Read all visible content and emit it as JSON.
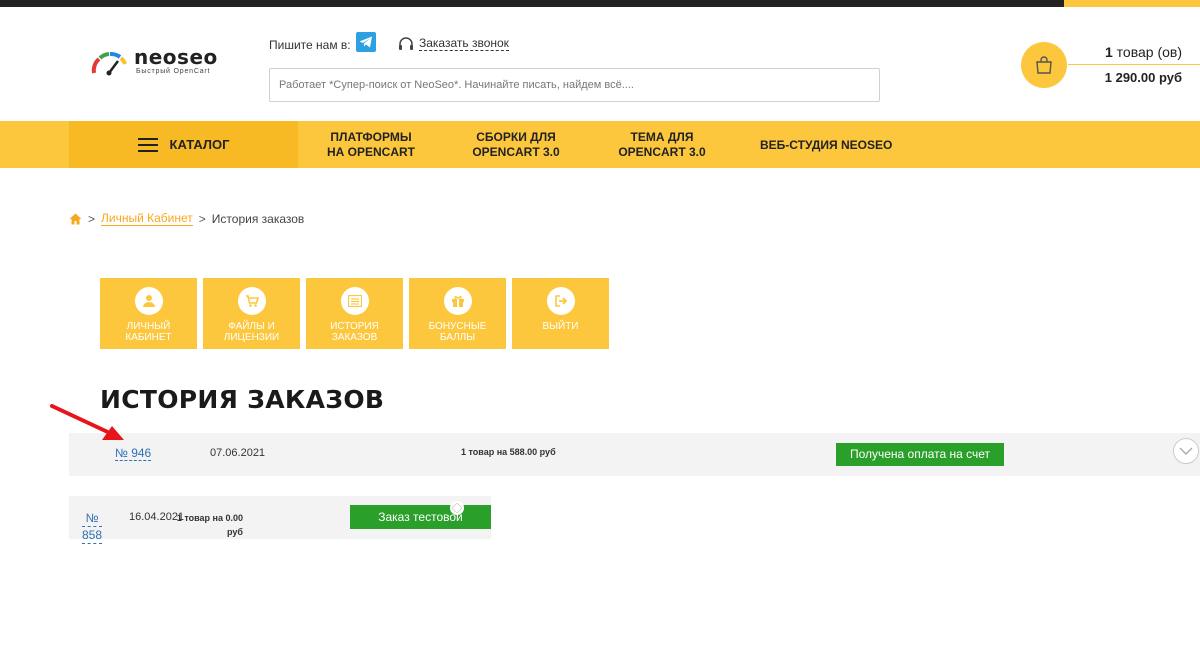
{
  "header": {
    "logo": {
      "name": "neoseo",
      "subtitle": "Быстрый OpenCart"
    },
    "write_us_label": "Пишите нам в:",
    "callback_label": "Заказать звонок",
    "search_placeholder": "Работает *Супер-поиск от NeoSeo*. Начинайте писать, найдем всё....",
    "cart": {
      "count_bold": "1",
      "count_rest": " товар (ов)",
      "total": "1 290.00 руб"
    }
  },
  "nav": {
    "catalog_label": "КАТАЛОГ",
    "items": [
      {
        "line1": "ПЛАТФОРМЫ",
        "line2": "НА OPENCART"
      },
      {
        "line1": "СБОРКИ ДЛЯ",
        "line2": "OPENCART 3.0"
      },
      {
        "line1": "ТЕМА ДЛЯ",
        "line2": "OPENCART 3.0"
      },
      {
        "line1": "ВЕБ-СТУДИЯ NEOSEO",
        "line2": ""
      }
    ]
  },
  "breadcrumb": {
    "separator": ">",
    "account_link": "Личный Кабинет",
    "current": "История заказов"
  },
  "tiles": [
    {
      "line1": "ЛИЧНЫЙ",
      "line2": "КАБИНЕТ",
      "icon": "user-icon"
    },
    {
      "line1": "ФАЙЛЫ И",
      "line2": "ЛИЦЕНЗИИ",
      "icon": "cart-icon"
    },
    {
      "line1": "ИСТОРИЯ",
      "line2": "ЗАКАЗОВ",
      "icon": "list-icon"
    },
    {
      "line1": "БОНУСНЫЕ",
      "line2": "БАЛЛЫ",
      "icon": "gift-icon"
    },
    {
      "line1": "ВЫЙТИ",
      "line2": "",
      "icon": "logout-icon"
    }
  ],
  "page_title": "ИСТОРИЯ ЗАКАЗОВ",
  "orders": [
    {
      "number": "№ 946",
      "date": "07.06.2021",
      "total": "1 товар на 588.00 руб",
      "status": "Получена оплата на счет"
    },
    {
      "number_line1": "№",
      "number_line2": "858",
      "date": "16.04.2021",
      "total_line1": "1 товар на 0.00",
      "total_line2": "руб",
      "status": "Заказ тестовой"
    }
  ],
  "colors": {
    "accent": "#fcc73d",
    "accent_dark": "#f7b924",
    "status_green": "#2aa02a",
    "link_blue": "#2d6fb8",
    "annotation_arrow": "#e8141c"
  }
}
